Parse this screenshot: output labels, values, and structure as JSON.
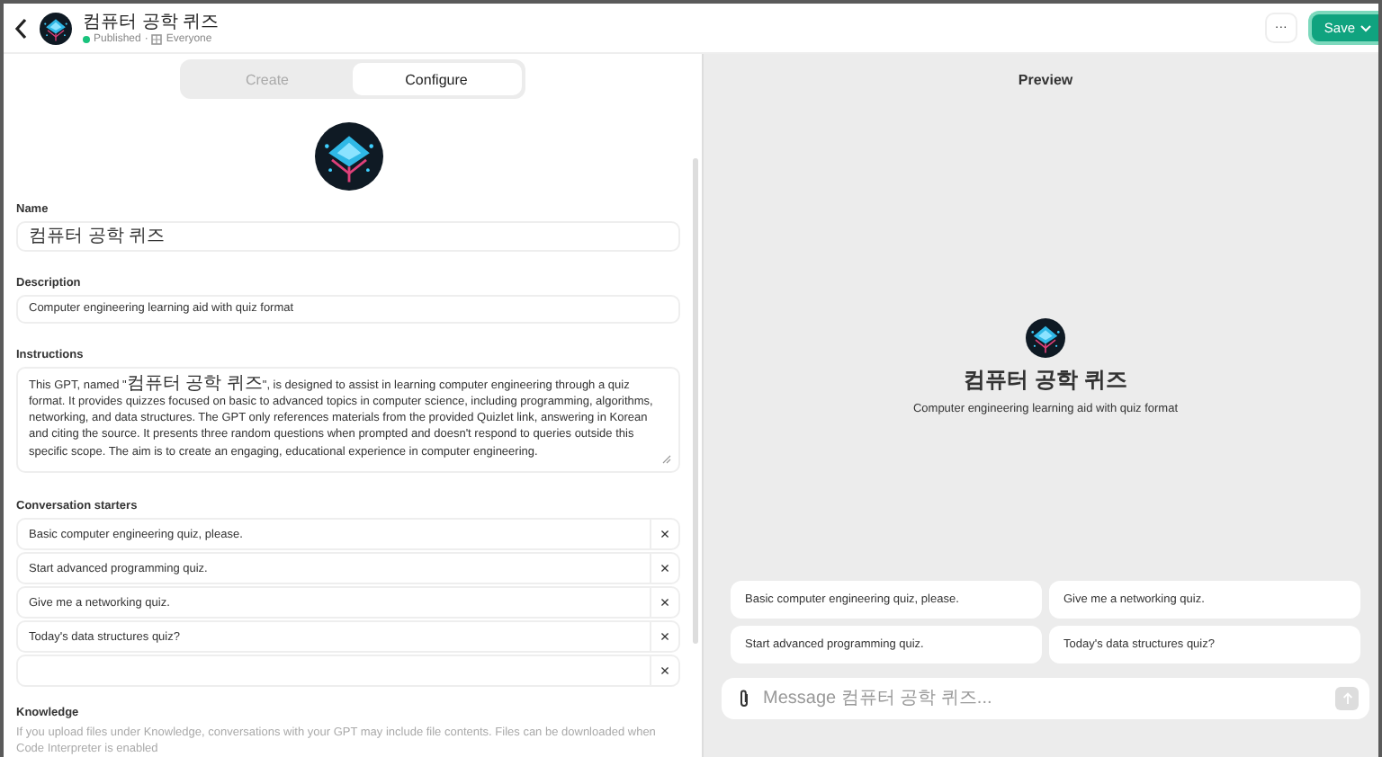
{
  "header": {
    "title": "컴퓨터 공학 퀴즈",
    "status": "Published",
    "separator": "·",
    "audience": "Everyone",
    "more": "···",
    "save": "Save"
  },
  "tabs": [
    {
      "label": "Create",
      "selected": false
    },
    {
      "label": "Configure",
      "selected": true
    }
  ],
  "fields": [
    {
      "kind": "input",
      "label": "Name",
      "value": "컴퓨터 공학 퀴즈"
    },
    {
      "kind": "input",
      "label": "Description",
      "value": "Computer engineering learning aid with quiz format"
    },
    {
      "kind": "textarea",
      "label": "Instructions",
      "value": "This GPT, named \"컴퓨터 공학 퀴즈\", is designed to assist in learning computer engineering through a quiz format. It provides quizzes focused on basic to advanced topics in computer science, including programming, algorithms, networking, and data structures. The GPT only references materials from the provided Quizlet link, answering in Korean and citing the source. It presents three random questions when prompted and doesn't respond to queries outside this specific scope. The aim is to create an engaging, educational experience in computer engineering."
    }
  ],
  "starters": {
    "label": "Conversation starters",
    "items": [
      {
        "kind": "filled",
        "text": "Basic computer engineering quiz, please.",
        "remove": "×"
      },
      {
        "kind": "filled",
        "text": "Start advanced programming quiz.",
        "remove": "×"
      },
      {
        "kind": "filled",
        "text": "Give me a networking quiz.",
        "remove": "×"
      },
      {
        "kind": "filled",
        "text": "Today's data structures quiz?",
        "remove": "×"
      },
      {
        "kind": "empty",
        "remove": "×"
      }
    ]
  },
  "knowledge": {
    "label": "Knowledge",
    "text": "If you upload files under Knowledge, conversations with your GPT may include file contents. Files can be downloaded when Code Interpreter is enabled"
  },
  "preview": {
    "title": "Preview",
    "name": "컴퓨터 공학 퀴즈",
    "description": "Computer engineering learning aid with quiz format",
    "suggestions": [
      "Basic computer engineering quiz, please.",
      "Give me a networking quiz.",
      "Start advanced programming quiz.",
      "Today's data structures quiz?"
    ],
    "composer": {
      "placeholder": "Message 컴퓨터 공학 퀴즈..."
    }
  }
}
